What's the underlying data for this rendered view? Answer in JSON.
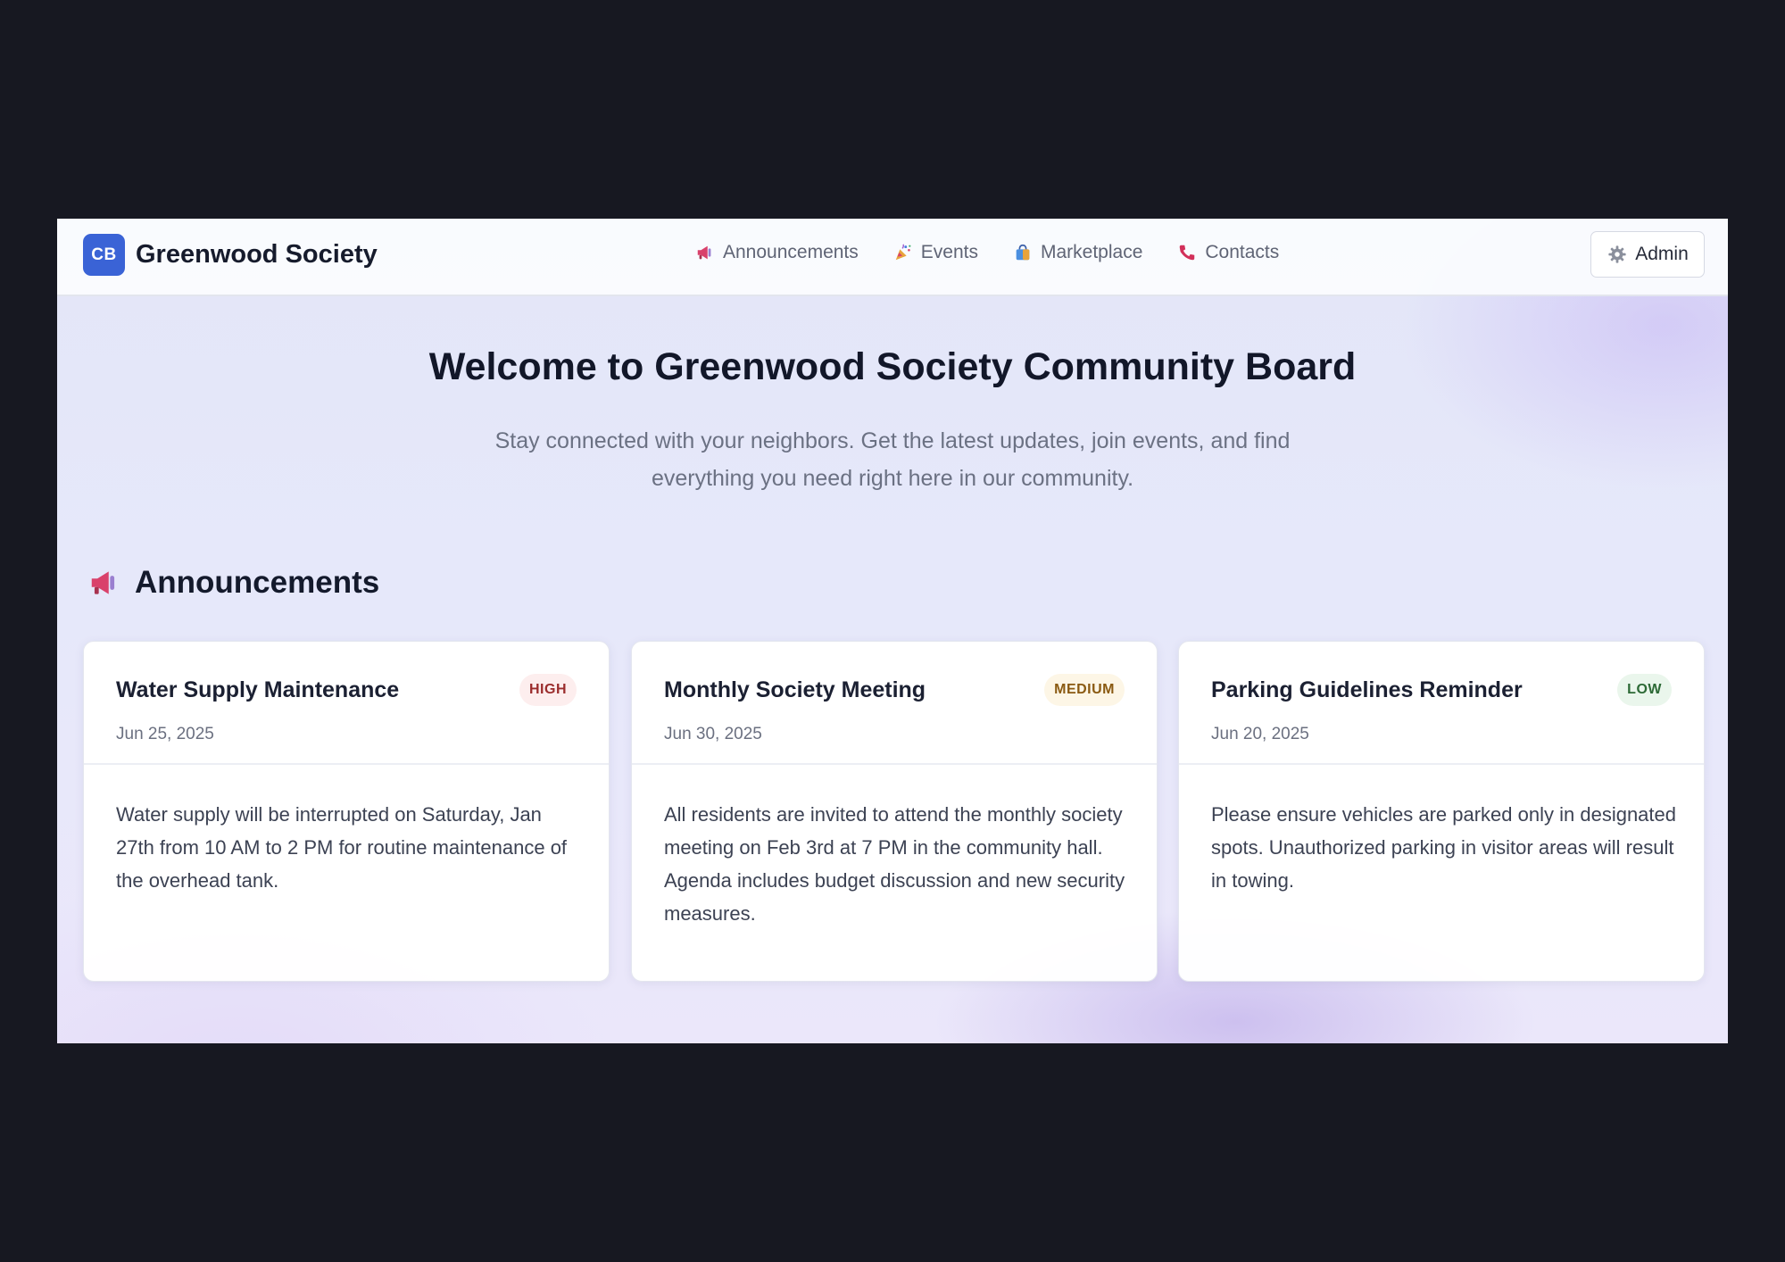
{
  "navbar": {
    "logo_text": "CB",
    "brand_name": "Greenwood Society",
    "links": [
      {
        "label": "Announcements",
        "icon": "megaphone-icon"
      },
      {
        "label": "Events",
        "icon": "party-popper-icon"
      },
      {
        "label": "Marketplace",
        "icon": "shopping-bag-icon"
      },
      {
        "label": "Contacts",
        "icon": "phone-icon"
      }
    ],
    "admin": {
      "label": "Admin",
      "icon": "gear-icon"
    }
  },
  "hero": {
    "title": "Welcome to Greenwood Society Community Board",
    "subtitle": "Stay connected with your neighbors. Get the latest updates, join events, and find everything you need right here in our community."
  },
  "announcements": {
    "section_title": "Announcements",
    "section_icon": "megaphone-icon",
    "cards": [
      {
        "title": "Water Supply Maintenance",
        "priority": "HIGH",
        "date": "Jun 25, 2025",
        "body": "Water supply will be interrupted on Saturday, Jan 27th from 10 AM to 2 PM for routine maintenance of the overhead tank."
      },
      {
        "title": "Monthly Society Meeting",
        "priority": "MEDIUM",
        "date": "Jun 30, 2025",
        "body": "All residents are invited to attend the monthly society meeting on Feb 3rd at 7 PM in the community hall. Agenda includes budget discussion and new security measures."
      },
      {
        "title": "Parking Guidelines Reminder",
        "priority": "LOW",
        "date": "Jun 20, 2025",
        "body": "Please ensure vehicles are parked only in designated spots. Unauthorized parking in visitor areas will result in towing."
      }
    ]
  },
  "colors": {
    "brand_blue": "#3a63d6",
    "high": "#9b2d2d",
    "medium": "#8a5a12",
    "low": "#2d6a36",
    "outer_background": "#171821"
  }
}
